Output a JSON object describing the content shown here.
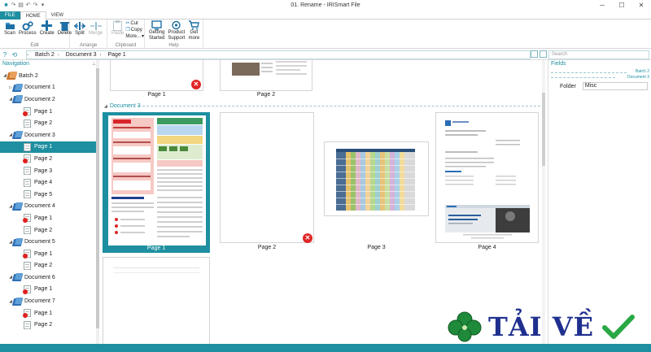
{
  "window": {
    "title": "01. Rename - IRISmart File",
    "minimize": "─",
    "maximize": "☐",
    "close": "✕"
  },
  "tabs": [
    {
      "label": "FILE"
    },
    {
      "label": "HOME"
    },
    {
      "label": "VIEW"
    }
  ],
  "ribbon": {
    "groups": {
      "edit": "Edit",
      "arrange": "Arrange",
      "clipboard": "Clipboard",
      "help": "Help"
    },
    "scan": "Scan",
    "process": "Process",
    "create": "Create",
    "delete": "Delete",
    "split": "Split",
    "merge": "Merge",
    "paste": "Paste",
    "cut": "Cut",
    "copy": "Copy",
    "more": "More...",
    "getting_started": [
      "Getting",
      "Started"
    ],
    "product_support": [
      "Product",
      "Support"
    ],
    "get_more": [
      "Get",
      "more"
    ]
  },
  "address": {
    "crumbs": [
      "Batch 2",
      "Document 3",
      "Page 1"
    ],
    "search_placeholder": "Search"
  },
  "navigation": {
    "title": "Navigation",
    "tree": [
      {
        "label": "Batch 2",
        "level": 0,
        "type": "batch",
        "expanded": true
      },
      {
        "label": "Document 1",
        "level": 1,
        "type": "doc",
        "expanded": false
      },
      {
        "label": "Document 2",
        "level": 1,
        "type": "doc",
        "expanded": true
      },
      {
        "label": "Page 1",
        "level": 2,
        "type": "page",
        "error": true
      },
      {
        "label": "Page 2",
        "level": 2,
        "type": "page",
        "error": false
      },
      {
        "label": "Document 3",
        "level": 1,
        "type": "doc",
        "expanded": true
      },
      {
        "label": "Page 1",
        "level": 2,
        "type": "page",
        "error": false,
        "selected": true
      },
      {
        "label": "Page 2",
        "level": 2,
        "type": "page",
        "error": true
      },
      {
        "label": "Page 3",
        "level": 2,
        "type": "page",
        "error": false
      },
      {
        "label": "Page 4",
        "level": 2,
        "type": "page",
        "error": false
      },
      {
        "label": "Page 5",
        "level": 2,
        "type": "page",
        "error": false
      },
      {
        "label": "Document 4",
        "level": 1,
        "type": "doc",
        "expanded": true
      },
      {
        "label": "Page 1",
        "level": 2,
        "type": "page",
        "error": true
      },
      {
        "label": "Page 2",
        "level": 2,
        "type": "page",
        "error": false
      },
      {
        "label": "Document 5",
        "level": 1,
        "type": "doc",
        "expanded": true
      },
      {
        "label": "Page 1",
        "level": 2,
        "type": "page",
        "error": true
      },
      {
        "label": "Page 2",
        "level": 2,
        "type": "page",
        "error": false
      },
      {
        "label": "Document 6",
        "level": 1,
        "type": "doc",
        "expanded": true
      },
      {
        "label": "Page 1",
        "level": 2,
        "type": "page",
        "error": true
      },
      {
        "label": "Document 7",
        "level": 1,
        "type": "doc",
        "expanded": true
      },
      {
        "label": "Page 1",
        "level": 2,
        "type": "page",
        "error": true
      },
      {
        "label": "Page 2",
        "level": 2,
        "type": "page",
        "error": false
      }
    ]
  },
  "main": {
    "top_pages": [
      {
        "label": "Page 1",
        "error": true
      },
      {
        "label": "Page 2",
        "error": false
      }
    ],
    "section_label": "Document 3",
    "pages": [
      {
        "label": "Page 1",
        "selected": true,
        "error": false
      },
      {
        "label": "Page 2",
        "selected": false,
        "error": true
      },
      {
        "label": "Page 3",
        "selected": false,
        "error": false
      },
      {
        "label": "Page 4",
        "selected": false,
        "error": false
      }
    ]
  },
  "fields": {
    "title": "Fields",
    "crumb_batch": "Batch 2",
    "crumb_doc": "Document 3",
    "folder_label": "Folder",
    "folder_value": "Misc"
  },
  "watermark": {
    "text": "TẢI VỀ"
  },
  "colors": {
    "accent": "#1e8fa0",
    "error": "#e02626",
    "watermark_text": "#1f2f8f",
    "watermark_check": "#2aa845",
    "watermark_clover": "#1f8a3a"
  }
}
